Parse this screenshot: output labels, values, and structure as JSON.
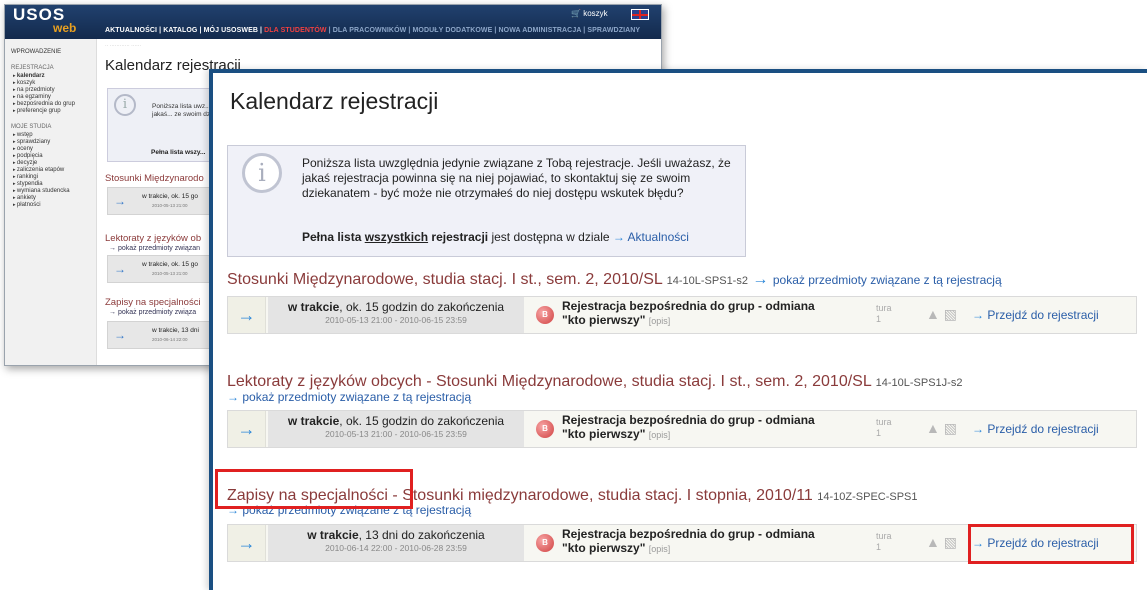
{
  "background_window": {
    "logo": "USOS",
    "logo_sub": "web",
    "cart": "koszyk",
    "nav": {
      "items_a": "AKTUALNOŚCI | KATALOG | MÓJ USOSWEB | ",
      "item_students": "DLA STUDENTÓW",
      "items_b": " | DLA PRACOWNIKÓW | MODUŁY DODATKOWE | NOWA ADMINISTRACJA | ",
      "item_check": "SPRAWDZIANY"
    },
    "sidebar": {
      "intro": "WPROWADZENIE",
      "registration_header": "REJESTRACJA",
      "registration_items": [
        "kalendarz",
        "koszyk",
        "na przedmioty",
        "na egzaminy",
        "bezpośrednia do grup",
        "preferencje grup"
      ],
      "studies_header": "MOJE STUDIA",
      "studies_items": [
        "wstęp",
        "sprawdziany",
        "oceny",
        "podpięcia",
        "decyzje",
        "zaliczenia etapów",
        "rankingi",
        "stypendia",
        "wymiana studencka",
        "ankiety",
        "płatności"
      ]
    },
    "title": "Kalendarz rejestracji",
    "info": "Poniższa lista uwz... uważasz, że jakaś... ze swoim dziekan... błędu?",
    "info_full": "Pełna lista wszy...",
    "sections": [
      {
        "title": "Stosunki Międzynarodo",
        "row_state": "w trakcie, ok. 15 go"
      },
      {
        "title": "Lektoraty z języków ob",
        "link": "pokaż przedmioty związan",
        "row_state": "w trakcie, ok. 15 go"
      },
      {
        "title": "Zapisy na specjalności",
        "link": "pokaż przedmioty związa",
        "row_state": "w trakcie, 13 dni"
      }
    ]
  },
  "main": {
    "page_title": "Kalendarz rejestracji",
    "info": {
      "text": "Poniższa lista uwzględnia jedynie związane z Tobą rejestracje. Jeśli uważasz, że jakaś rejestracja powinna się na niej pojawiać, to skontaktuj się ze swoim dziekanatem - być może nie otrzymałeś do niej dostępu wskutek błędu?",
      "full_list_a": "Pełna lista ",
      "full_list_b": "wszystkich",
      "full_list_c": " rejestracji",
      "full_list_d": " jest dostępna w dziale ",
      "full_list_link": "Aktualności"
    },
    "sections": [
      {
        "title": "Stosunki Międzynarodowe, studia stacj. I st., sem. 2, 2010/SL",
        "code": "14-10L-SPS1-s2",
        "link": "pokaż przedmioty związane z tą rejestracją",
        "row": {
          "state_bold": "w trakcie",
          "state_rest": ", ok. 15 godzin do zakończenia",
          "dates": "2010-05-13 21:00 - 2010-06-15 23:59",
          "badge": "B",
          "type_line1": "Rejestracja bezpośrednia do grup - odmiana",
          "type_line2": "\"kto pierwszy\"",
          "opis": "[opis]",
          "tura_label": "tura",
          "tura_value": "1",
          "go": "Przejdź do rejestracji"
        }
      },
      {
        "title": "Lektoraty z języków obcych - Stosunki Międzynarodowe, studia stacj. I st., sem. 2, 2010/SL",
        "code": "14-10L-SPS1J-s2",
        "link": "pokaż przedmioty związane z tą rejestracją",
        "row": {
          "state_bold": "w trakcie",
          "state_rest": ", ok. 15 godzin do zakończenia",
          "dates": "2010-05-13 21:00 - 2010-06-15 23:59",
          "badge": "B",
          "type_line1": "Rejestracja bezpośrednia do grup - odmiana",
          "type_line2": "\"kto pierwszy\"",
          "opis": "[opis]",
          "tura_label": "tura",
          "tura_value": "1",
          "go": "Przejdź do rejestracji"
        }
      },
      {
        "title": "Zapisy na specjalności - Stosunki międzynarodowe, studia stacj. I stopnia, 2010/11",
        "code": "14-10Z-SPEC-SPS1",
        "link": "pokaż przedmioty związane z tą rejestracją",
        "row": {
          "state_bold": "w trakcie",
          "state_rest": ", 13 dni do zakończenia",
          "dates": "2010-06-14 22:00 - 2010-06-28 23:59",
          "badge": "B",
          "type_line1": "Rejestracja bezpośrednia do grup - odmiana",
          "type_line2": "\"kto pierwszy\"",
          "opis": "[opis]",
          "tura_label": "tura",
          "tura_value": "1",
          "go": "Przejdź do rejestracji"
        }
      }
    ]
  },
  "colors": {
    "header_bg": "#132a4d",
    "section_title": "#8a3b3b",
    "link": "#2a5ea8",
    "arrow": "#2a86d8",
    "highlight": "#e02020"
  }
}
